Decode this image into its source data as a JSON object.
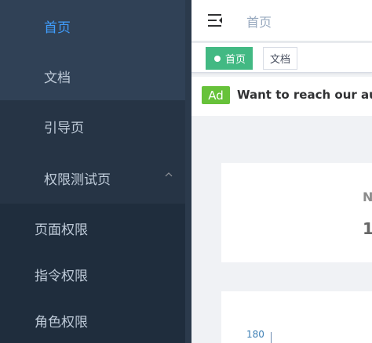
{
  "sidebar": {
    "items": [
      {
        "label": "首页"
      },
      {
        "label": "文档"
      },
      {
        "label": "引导页"
      },
      {
        "label": "权限测试页"
      }
    ],
    "subitems": [
      {
        "label": "页面权限"
      },
      {
        "label": "指令权限"
      },
      {
        "label": "角色权限"
      }
    ]
  },
  "navbar": {
    "breadcrumb": "首页"
  },
  "tags": [
    {
      "label": "首页"
    },
    {
      "label": "文档"
    }
  ],
  "ad": {
    "badge": "Ad",
    "text": "Want to reach our audience"
  },
  "card": {
    "title": "N",
    "value": "1"
  },
  "chart": {
    "tick": "180"
  },
  "colors": {
    "sidebar_bg": "#304156",
    "active": "#409eff",
    "tag_active": "#42b983",
    "ad": "#67c23a"
  }
}
